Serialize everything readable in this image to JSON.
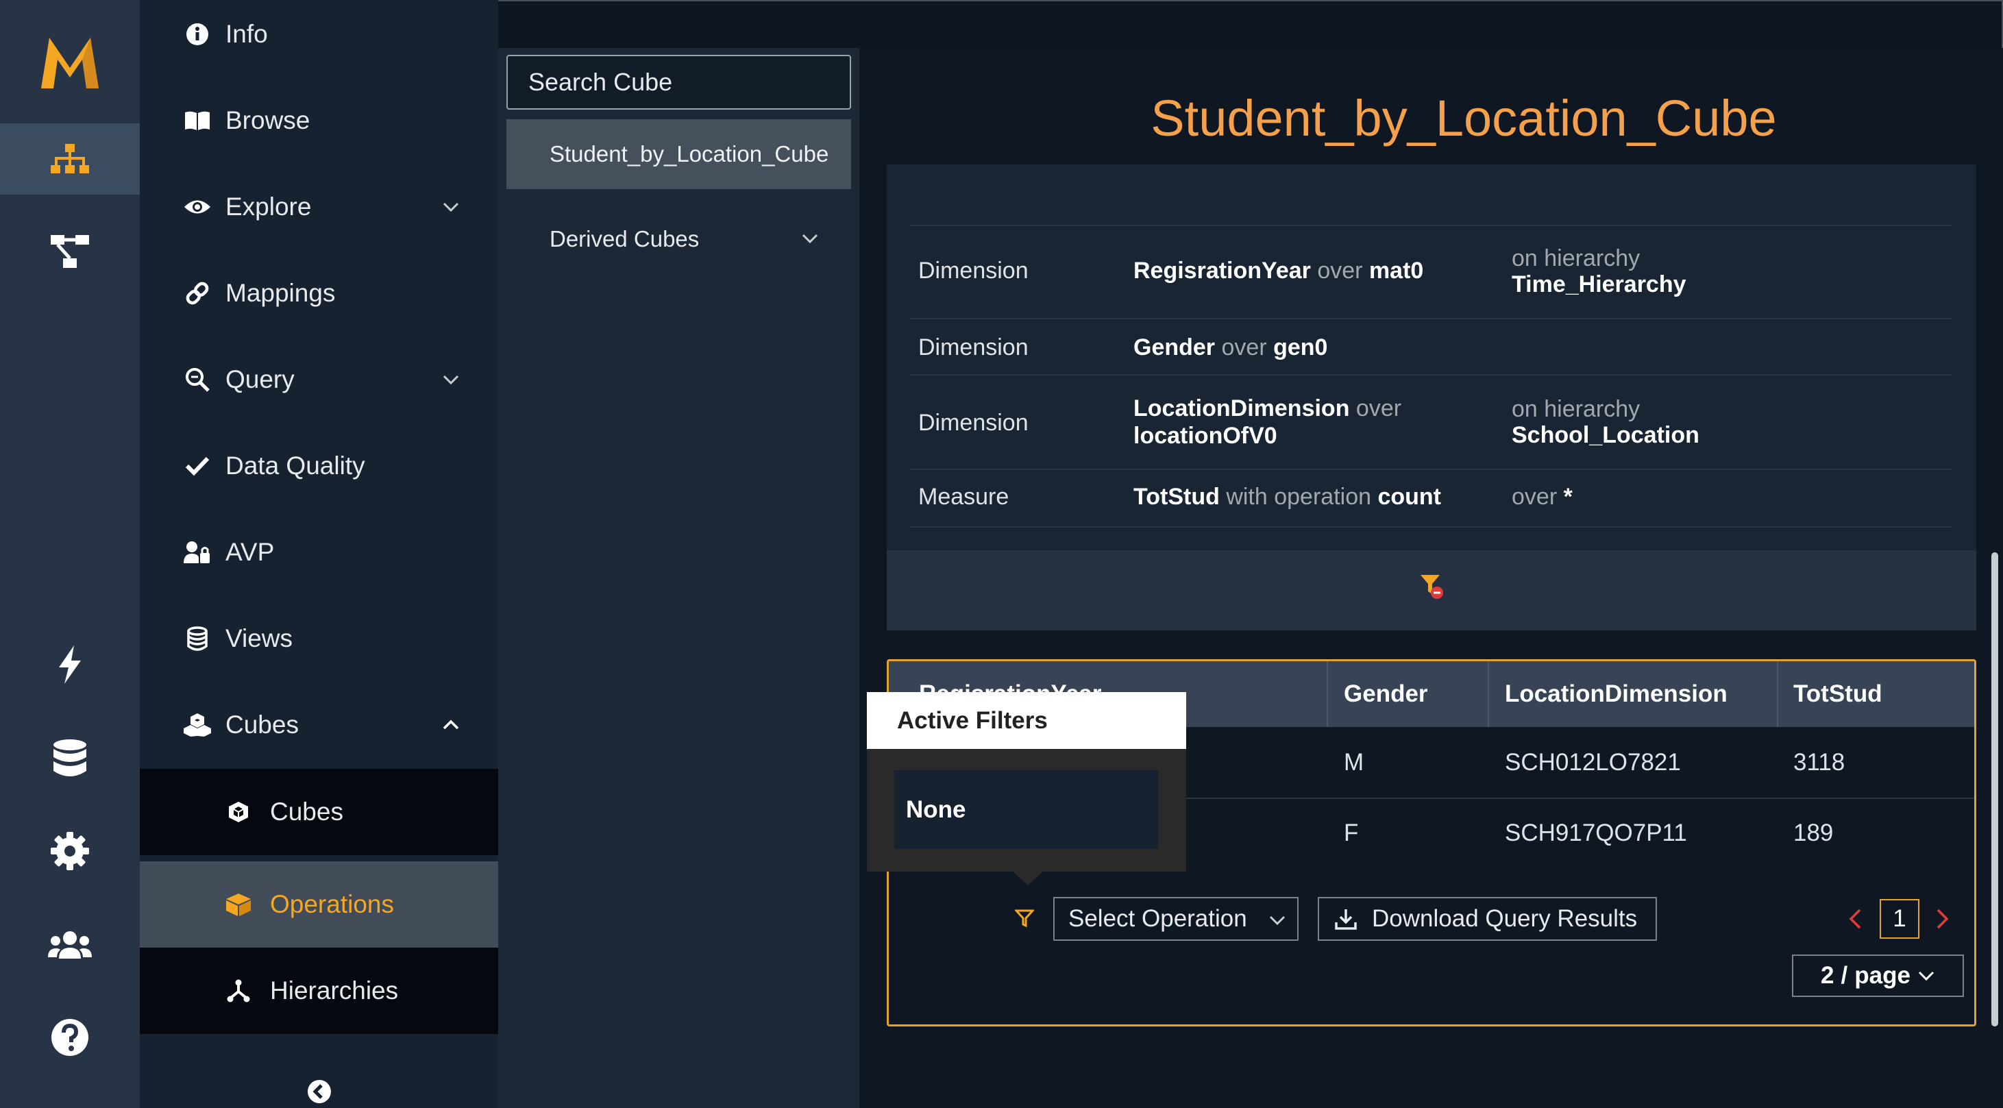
{
  "app": {
    "logo_letter": "M",
    "accent": "#f5a623"
  },
  "rail": {
    "items": [
      {
        "icon": "hierarchy-icon",
        "active": true
      },
      {
        "icon": "flow-icon",
        "active": false
      },
      {
        "icon": "lightning-icon",
        "active": false
      },
      {
        "icon": "database-icon",
        "active": false
      },
      {
        "icon": "gear-icon",
        "active": false
      },
      {
        "icon": "users-icon",
        "active": false
      },
      {
        "icon": "help-icon",
        "active": false
      }
    ]
  },
  "nav": {
    "items": [
      {
        "label": "Info",
        "icon": "info-icon"
      },
      {
        "label": "Browse",
        "icon": "book-icon"
      },
      {
        "label": "Explore",
        "icon": "eye-icon",
        "expandable": true
      },
      {
        "label": "Mappings",
        "icon": "link-icon"
      },
      {
        "label": "Query",
        "icon": "query-icon",
        "expandable": true
      },
      {
        "label": "Data Quality",
        "icon": "check-icon"
      },
      {
        "label": "AVP",
        "icon": "user-lock-icon"
      },
      {
        "label": "Views",
        "icon": "layers-icon"
      },
      {
        "label": "Cubes",
        "icon": "cubes-icon",
        "expanded": true
      }
    ],
    "sub_items": [
      {
        "label": "Cubes",
        "icon": "cube-icon"
      },
      {
        "label": "Operations",
        "icon": "box-open-icon",
        "active": true
      },
      {
        "label": "Hierarchies",
        "icon": "hierarchy-tree-icon"
      }
    ]
  },
  "cube_list": {
    "search_placeholder": "Search Cube",
    "selected": "Student_by_Location_Cube",
    "derived_label": "Derived Cubes"
  },
  "main": {
    "title": "Student_by_Location_Cube",
    "schema": [
      {
        "kind": "Dimension",
        "name": "RegisrationYear",
        "join": "over",
        "target": "mat0",
        "hier_label": "on hierarchy",
        "hierarchy": "Time_Hierarchy"
      },
      {
        "kind": "Dimension",
        "name": "Gender",
        "join": "over",
        "target": "gen0",
        "hier_label": "",
        "hierarchy": ""
      },
      {
        "kind": "Dimension",
        "name": "LocationDimension",
        "join": "over",
        "target": "locationOfV0",
        "hier_label": "on hierarchy",
        "hierarchy": "School_Location"
      },
      {
        "kind": "Measure",
        "name": "TotStud",
        "join": "with operation",
        "target": "count",
        "hier_label": "over",
        "hierarchy": "*"
      }
    ],
    "table": {
      "columns": [
        "RegisrationYear",
        "Gender",
        "LocationDimension",
        "TotStud"
      ],
      "rows": [
        [
          "",
          "M",
          "SCH012LO7821",
          "3118"
        ],
        [
          "",
          "F",
          "SCH917QO7P11",
          "189"
        ]
      ]
    },
    "controls": {
      "select_operation": "Select Operation",
      "download": "Download Query Results",
      "page": "1",
      "per_page": "2",
      "per_page_sep": "/",
      "per_page_unit": "page"
    },
    "popover": {
      "title": "Active Filters",
      "value": "None"
    }
  }
}
